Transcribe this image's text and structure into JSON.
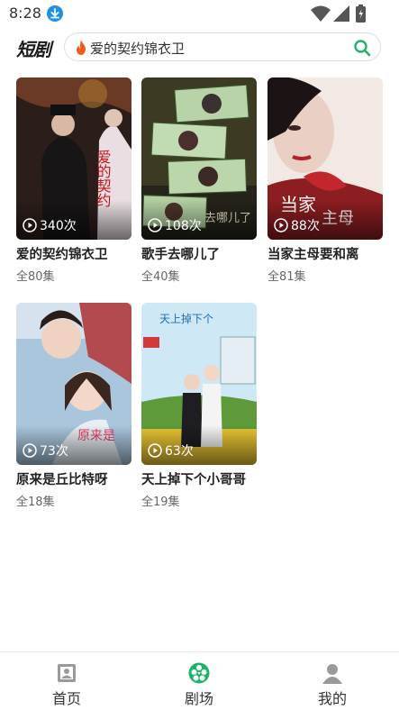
{
  "status_bar": {
    "time": "8:28",
    "icons": [
      "download-icon",
      "wifi-icon",
      "signal-icon",
      "battery-icon"
    ]
  },
  "header": {
    "logo": "短剧",
    "search": {
      "text": "爱的契约锦衣卫",
      "leading_icon": "fire-icon",
      "trailing_icon": "search-icon",
      "icon_color": "#22b36b"
    }
  },
  "dramas": [
    {
      "title": "爱的契约锦衣卫",
      "episodes": "全80集",
      "views": "340次"
    },
    {
      "title": "歌手去哪儿了",
      "episodes": "全40集",
      "views": "108次"
    },
    {
      "title": "当家主母要和离",
      "episodes": "全81集",
      "views": "88次"
    },
    {
      "title": "原来是丘比特呀",
      "episodes": "全18集",
      "views": "73次"
    },
    {
      "title": "天上掉下个小哥哥",
      "episodes": "全19集",
      "views": "63次"
    }
  ],
  "bottom_nav": {
    "active_color": "#1fb36a",
    "items": [
      {
        "label": "首页",
        "icon": "home-icon",
        "active": false
      },
      {
        "label": "剧场",
        "icon": "film-reel-icon",
        "active": true
      },
      {
        "label": "我的",
        "icon": "profile-icon",
        "active": false
      }
    ]
  }
}
